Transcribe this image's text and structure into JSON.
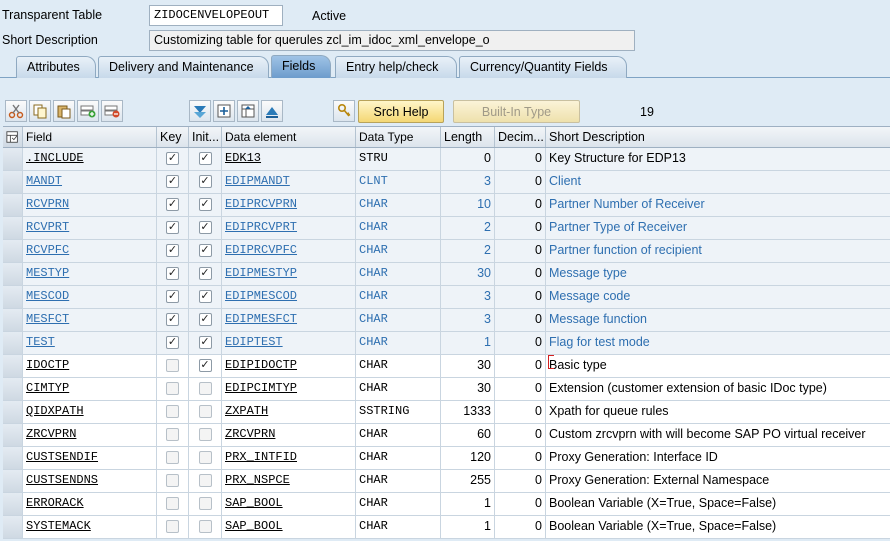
{
  "header": {
    "table_type_label": "Transparent Table",
    "table_name": "ZIDOCENVELOPEOUT",
    "status": "Active",
    "short_desc_label": "Short Description",
    "short_desc_value": "Customizing table for querules zcl_im_idoc_xml_envelope_o"
  },
  "tabs": [
    {
      "label": "Attributes",
      "active": false
    },
    {
      "label": "Delivery and Maintenance",
      "active": false
    },
    {
      "label": "Fields",
      "active": true
    },
    {
      "label": "Entry help/check",
      "active": false
    },
    {
      "label": "Currency/Quantity Fields",
      "active": false
    }
  ],
  "toolbar": {
    "icons": [
      "cut-icon",
      "copy-icon",
      "paste-icon",
      "insert-row-icon",
      "delete-row-icon",
      "new-rows-icon",
      "move-icon",
      "table-settings-icon",
      "upload-icon",
      "search-help-icon"
    ],
    "srch_help_label": "Srch Help",
    "builtin_type_label": "Built-In Type",
    "row_count": "19"
  },
  "columns": {
    "field": "Field",
    "key": "Key",
    "init": "Init...",
    "data_element": "Data element",
    "data_type": "Data Type",
    "length": "Length",
    "decimals": "Decim...",
    "short_description": "Short Description"
  },
  "rows": [
    {
      "field": ".INCLUDE",
      "key": true,
      "init": true,
      "data_element": "EDK13",
      "data_type": "STRU",
      "length": "0",
      "decimals": "0",
      "desc": "Key Structure for EDP13",
      "std": true,
      "blue": false
    },
    {
      "field": "MANDT",
      "key": true,
      "init": true,
      "data_element": "EDIPMANDT",
      "data_type": "CLNT",
      "length": "3",
      "decimals": "0",
      "desc": "Client",
      "std": true,
      "blue": true
    },
    {
      "field": "RCVPRN",
      "key": true,
      "init": true,
      "data_element": "EDIPRCVPRN",
      "data_type": "CHAR",
      "length": "10",
      "decimals": "0",
      "desc": "Partner Number of Receiver",
      "std": true,
      "blue": true
    },
    {
      "field": "RCVPRT",
      "key": true,
      "init": true,
      "data_element": "EDIPRCVPRT",
      "data_type": "CHAR",
      "length": "2",
      "decimals": "0",
      "desc": "Partner Type of Receiver",
      "std": true,
      "blue": true
    },
    {
      "field": "RCVPFC",
      "key": true,
      "init": true,
      "data_element": "EDIPRCVPFC",
      "data_type": "CHAR",
      "length": "2",
      "decimals": "0",
      "desc": "Partner function of recipient",
      "std": true,
      "blue": true
    },
    {
      "field": "MESTYP",
      "key": true,
      "init": true,
      "data_element": "EDIPMESTYP",
      "data_type": "CHAR",
      "length": "30",
      "decimals": "0",
      "desc": "Message type",
      "std": true,
      "blue": true
    },
    {
      "field": "MESCOD",
      "key": true,
      "init": true,
      "data_element": "EDIPMESCOD",
      "data_type": "CHAR",
      "length": "3",
      "decimals": "0",
      "desc": "Message code",
      "std": true,
      "blue": true
    },
    {
      "field": "MESFCT",
      "key": true,
      "init": true,
      "data_element": "EDIPMESFCT",
      "data_type": "CHAR",
      "length": "3",
      "decimals": "0",
      "desc": "Message function",
      "std": true,
      "blue": true
    },
    {
      "field": "TEST",
      "key": true,
      "init": true,
      "data_element": "EDIPTEST",
      "data_type": "CHAR",
      "length": "1",
      "decimals": "0",
      "desc": "Flag for test mode",
      "std": true,
      "blue": true
    },
    {
      "field": "IDOCTP",
      "key": false,
      "init": true,
      "data_element": "EDIPIDOCTP",
      "data_type": "CHAR",
      "length": "30",
      "decimals": "0",
      "desc": "Basic type",
      "std": false,
      "blue": false
    },
    {
      "field": "CIMTYP",
      "key": false,
      "init": false,
      "data_element": "EDIPCIMTYP",
      "data_type": "CHAR",
      "length": "30",
      "decimals": "0",
      "desc": "Extension (customer extension of basic IDoc type)",
      "std": false,
      "blue": false
    },
    {
      "field": "QIDXPATH",
      "key": false,
      "init": false,
      "data_element": "ZXPATH",
      "data_type": "SSTRING",
      "length": "1333",
      "decimals": "0",
      "desc": "Xpath for queue rules",
      "std": false,
      "blue": false
    },
    {
      "field": "ZRCVPRN",
      "key": false,
      "init": false,
      "data_element": "ZRCVPRN",
      "data_type": "CHAR",
      "length": "60",
      "decimals": "0",
      "desc": "Custom zrcvprn with will become SAP PO virtual receiver",
      "std": false,
      "blue": false
    },
    {
      "field": "CUSTSENDIF",
      "key": false,
      "init": false,
      "data_element": "PRX_INTFID",
      "data_type": "CHAR",
      "length": "120",
      "decimals": "0",
      "desc": "Proxy Generation: Interface ID",
      "std": false,
      "blue": false
    },
    {
      "field": "CUSTSENDNS",
      "key": false,
      "init": false,
      "data_element": "PRX_NSPCE",
      "data_type": "CHAR",
      "length": "255",
      "decimals": "0",
      "desc": "Proxy Generation: External Namespace",
      "std": false,
      "blue": false
    },
    {
      "field": "ERRORACK",
      "key": false,
      "init": false,
      "data_element": "SAP_BOOL",
      "data_type": "CHAR",
      "length": "1",
      "decimals": "0",
      "desc": "Boolean Variable (X=True, Space=False)",
      "std": false,
      "blue": false
    },
    {
      "field": "SYSTEMACK",
      "key": false,
      "init": false,
      "data_element": "SAP_BOOL",
      "data_type": "CHAR",
      "length": "1",
      "decimals": "0",
      "desc": "Boolean Variable (X=True, Space=False)",
      "std": false,
      "blue": false
    }
  ],
  "colors": {
    "background": "#dfebf5",
    "link_blue": "#2e6fb0",
    "active_tab": "#6d9ccc",
    "button_yellow": "#f4d774"
  }
}
